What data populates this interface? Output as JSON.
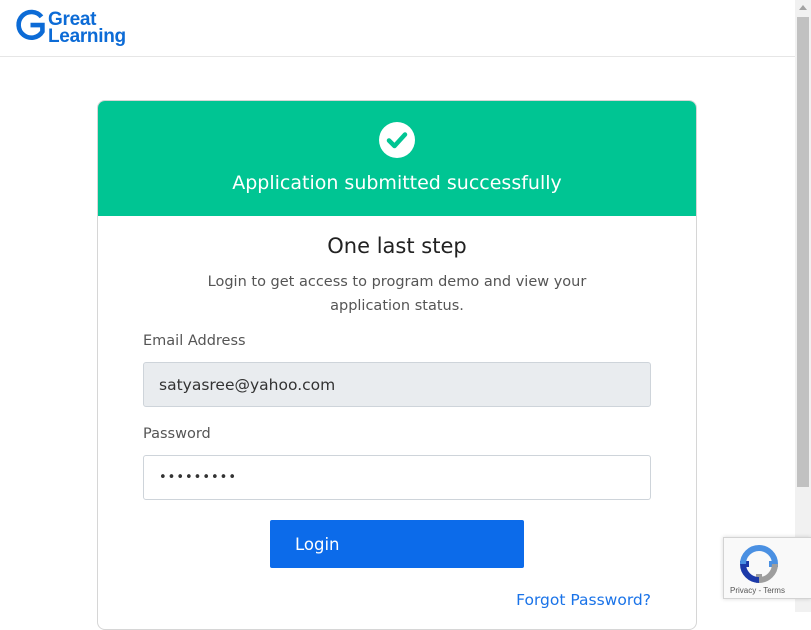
{
  "header": {
    "logo_line1": "Great",
    "logo_line2": "Learning",
    "logo_icon": "great-learning-logo-icon"
  },
  "banner": {
    "icon": "check-circle-icon",
    "title": "Application submitted successfully",
    "color": "#00c593"
  },
  "form": {
    "step_title": "One last step",
    "subtitle": "Login to get access to program demo and view your application status.",
    "email_label": "Email Address",
    "email_value": "satyasree@yahoo.com",
    "password_label": "Password",
    "password_value": "•••••••••",
    "login_label": "Login",
    "forgot_label": "Forgot Password?",
    "accent_color": "#0c6bea"
  },
  "recaptcha": {
    "icon": "recaptcha-icon",
    "terms": "Privacy - Terms"
  }
}
